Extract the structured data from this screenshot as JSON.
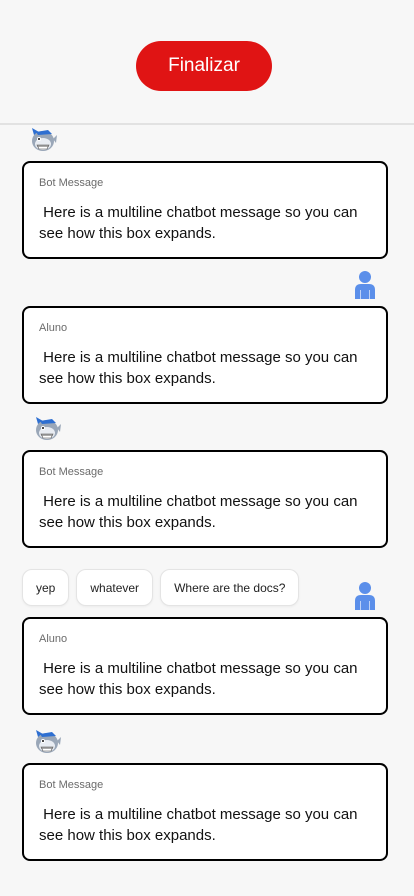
{
  "header": {
    "finish_label": "Finalizar",
    "finish_color": "#e01414"
  },
  "chips": [
    {
      "label": "yep"
    },
    {
      "label": "whatever"
    },
    {
      "label": "Where are the docs?"
    }
  ],
  "messages": [
    {
      "role": "bot",
      "sender": "Bot Message",
      "text": " Here is a multiline chatbot message so you can see how this box expands.",
      "avatar_icon": "shark-bot-icon"
    },
    {
      "role": "user",
      "sender": "Aluno",
      "text": " Here is a multiline chatbot message so you can see how this box expands.",
      "avatar_icon": "user-icon"
    },
    {
      "role": "bot",
      "sender": "Bot Message",
      "text": " Here is a multiline chatbot message so you can see how this box expands.",
      "avatar_icon": "shark-bot-icon"
    },
    {
      "role": "user",
      "sender": "Aluno",
      "text": " Here is a multiline chatbot message so you can see how this box expands.",
      "avatar_icon": "user-icon"
    },
    {
      "role": "bot",
      "sender": "Bot Message",
      "text": " Here is a multiline chatbot message so you can see how this box expands.",
      "avatar_icon": "shark-bot-icon"
    }
  ],
  "colors": {
    "user_icon": "#5b8fea",
    "border": "#000000"
  }
}
